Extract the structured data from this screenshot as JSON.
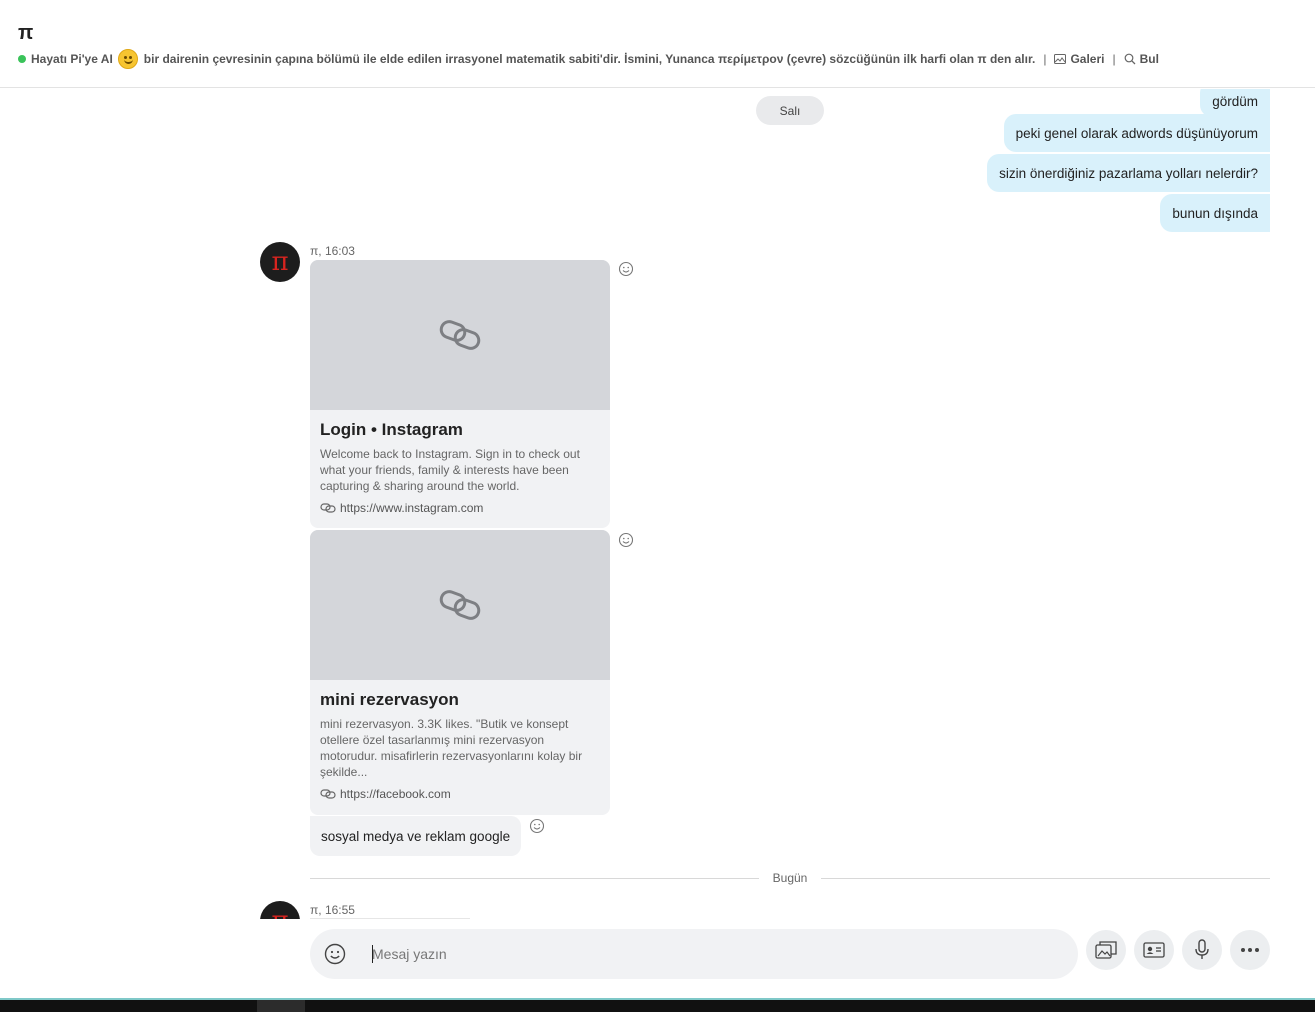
{
  "header": {
    "title": "π",
    "status_prefix": "Hayatı Pi'ye AI",
    "status_text": "bir dairenin çevresinin çapına bölümü ile elde edilen irrasyonel matematik sabiti'dir. İsmini, Yunanca περίμετρον (çevre) sözcüğünün ilk harfi olan π den alır.",
    "separator": "|",
    "gallery_label": "Galeri",
    "find_label": "Bul"
  },
  "conversation": {
    "day_pill": "Salı",
    "outgoing": [
      {
        "text": "gördüm"
      },
      {
        "text": "peki genel olarak adwords düşünüyorum"
      },
      {
        "text": "sizin önerdiğiniz pazarlama yolları nelerdir?"
      },
      {
        "text": "bunun dışında"
      }
    ],
    "sender_avatar": "π",
    "group1_meta": "π, 16:03",
    "cards": [
      {
        "title": "Login • Instagram",
        "description": "Welcome back to Instagram. Sign in to check out what your friends, family & interests have been capturing & sharing around the world.",
        "url": "https://www.instagram.com"
      },
      {
        "title": "mini rezervasyon",
        "description": "mini rezervasyon. 3.3K likes. \"Butik ve konsept otellere özel tasarlanmış mini rezervasyon motorudur. misafirlerin rezervasyonlarını kolay bir şekilde...",
        "url": "https://facebook.com"
      }
    ],
    "incoming_text": "sosyal medya ve reklam google",
    "divider_label": "Bugün",
    "group2_meta": "π, 16:55"
  },
  "composer": {
    "placeholder": "Mesaj yazın",
    "value": ""
  },
  "icons": {
    "gallery": "image-icon",
    "find": "search-icon",
    "link": "link-icon",
    "emoji": "smiley-icon",
    "media": "gallery-icon",
    "contact": "contact-card-icon",
    "mic": "microphone-icon",
    "more": "more-options-icon"
  },
  "colors": {
    "online": "#3ac35a",
    "outgoing_bubble": "#d9f1fb",
    "incoming_bubble": "#f1f2f4",
    "avatar_pi": "#d8241f"
  }
}
